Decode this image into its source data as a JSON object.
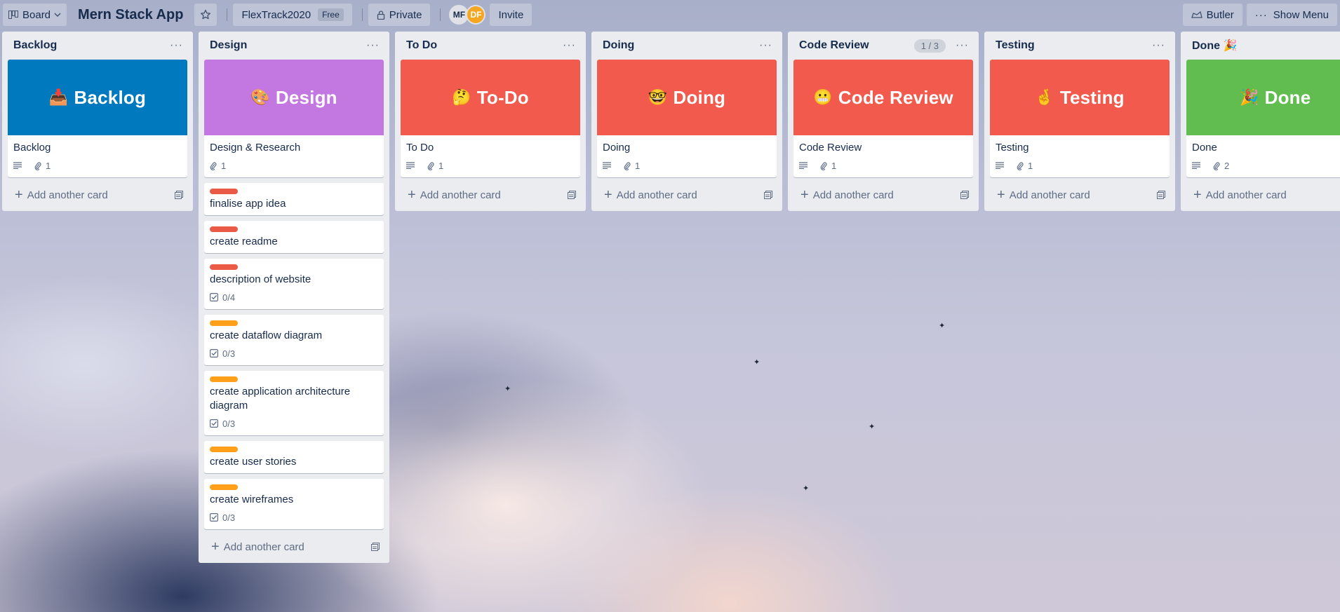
{
  "header": {
    "view_label": "Board",
    "board_name": "Mern Stack App",
    "workspace": "FlexTrack2020",
    "plan_badge": "Free",
    "visibility": "Private",
    "members": [
      {
        "initials": "MF",
        "color": "#dfe1e6"
      },
      {
        "initials": "DF",
        "color": "#f5a623"
      }
    ],
    "invite_label": "Invite",
    "butler_label": "Butler",
    "show_menu_label": "Show Menu"
  },
  "lists": [
    {
      "title": "Backlog",
      "cover": {
        "emoji": "📥",
        "text": "Backlog",
        "color": "#0079bf"
      },
      "cards": [
        {
          "title": "Backlog",
          "description": true,
          "attachments": "1"
        }
      ],
      "add_label": "Add another card"
    },
    {
      "title": "Design",
      "cover": {
        "emoji": "🎨",
        "text": "Design",
        "color": "#c377e0"
      },
      "cards": [
        {
          "title": "Design & Research",
          "description": false,
          "attachments": "1"
        },
        {
          "title": "finalise app idea",
          "label_color": "#eb5a46"
        },
        {
          "title": "create readme",
          "label_color": "#eb5a46"
        },
        {
          "title": "description of website",
          "label_color": "#eb5a46",
          "checklist": "0/4"
        },
        {
          "title": "create dataflow diagram",
          "label_color": "#ff9f1a",
          "checklist": "0/3"
        },
        {
          "title": "create application architecture diagram",
          "label_color": "#ff9f1a",
          "checklist": "0/3"
        },
        {
          "title": "create user stories",
          "label_color": "#ff9f1a"
        },
        {
          "title": "create wireframes",
          "label_color": "#ff9f1a",
          "checklist": "0/3"
        }
      ],
      "add_label": "Add another card"
    },
    {
      "title": "To Do",
      "cover": {
        "emoji": "🤔",
        "text": "To-Do",
        "color": "#f15a4c"
      },
      "cards": [
        {
          "title": "To Do",
          "description": true,
          "attachments": "1"
        }
      ],
      "add_label": "Add another card"
    },
    {
      "title": "Doing",
      "cover": {
        "emoji": "🤓",
        "text": "Doing",
        "color": "#f15a4c"
      },
      "cards": [
        {
          "title": "Doing",
          "description": true,
          "attachments": "1"
        }
      ],
      "add_label": "Add another card"
    },
    {
      "title": "Code Review",
      "count": "1 / 3",
      "cover": {
        "emoji": "😬",
        "text": "Code Review",
        "color": "#f15a4c"
      },
      "cards": [
        {
          "title": "Code Review",
          "description": true,
          "attachments": "1"
        }
      ],
      "add_label": "Add another card"
    },
    {
      "title": "Testing",
      "cover": {
        "emoji": "🤞",
        "text": "Testing",
        "color": "#f15a4c"
      },
      "cards": [
        {
          "title": "Testing",
          "description": true,
          "attachments": "1"
        }
      ],
      "add_label": "Add another card"
    },
    {
      "title": "Done 🎉",
      "cover": {
        "emoji": "🎉",
        "text": "Done",
        "color": "#61bd4f"
      },
      "cards": [
        {
          "title": "Done",
          "description": true,
          "attachments": "2"
        }
      ],
      "add_label": "Add another card"
    }
  ]
}
